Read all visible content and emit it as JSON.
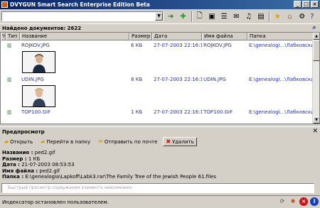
{
  "window": {
    "title": "DVYGUN Smart Search Enterprise Edition Beta"
  },
  "toolbar": {
    "search_value": "",
    "icons": [
      "go-arrow-icon",
      "add-icon",
      "doc-icon",
      "image-icon",
      "text-icon",
      "mail-icon",
      "music-icon",
      "film-icon",
      "favorite-star-icon",
      "home-folder-icon",
      "gear-icon",
      "help-icon"
    ]
  },
  "docbar": {
    "label": "Найдено документов:",
    "count": "2622"
  },
  "grid": {
    "columns": [
      "%",
      "Тип",
      "Название",
      "Размер",
      "Дата",
      "Имя файла",
      "Папка"
    ],
    "rows": [
      {
        "name": "ROJKOV.JPG",
        "size": "6 КБ",
        "date": "27-07-2003 22:16:16",
        "filename": "ROJKOV.JPG",
        "folder": "E:\\genealogi...\\Лабковский\\"
      },
      {
        "name": "UDIN.JPG",
        "size": "8 КБ",
        "date": "27-07-2003 22:16:16",
        "filename": "UDIN.JPG",
        "folder": "E:\\genealogi...\\Лабковский\\"
      },
      {
        "name": "TOP100.GIF",
        "size": "1 КБ",
        "date": "27-07-2003 22:16:16",
        "filename": "TOP100.GIF",
        "folder": "E:\\genealogi...\\Лабковский\\"
      }
    ]
  },
  "preview": {
    "title": "Предпросмотр",
    "buttons": {
      "open": "Открыть",
      "goto": "Перейти в папку",
      "send": "Отправить по почте",
      "delete": "Удалить"
    },
    "info": {
      "name_label": "Название :",
      "name": "ped2.gif",
      "size_label": "Размер :",
      "size": "1 КБ",
      "date_label": "Дата :",
      "date": "21-07-2003 08:53:53",
      "filename_label": "Имя файла :",
      "filename": "ped2.gif",
      "folder_label": "Папка :",
      "folder": "E:\\genealogia\\Lapkoff\\Labk3.rar\\The Family Tree of the Jewish People 61.files"
    },
    "quickview_text": "Быстрый просмотр содержания элемента невозможен"
  },
  "status": {
    "text": "Индексатор остановлен пользователем."
  },
  "colors": {
    "link": "#1c2fd0",
    "titlebar": "#0a246a",
    "panel": "#d4d0c8"
  }
}
